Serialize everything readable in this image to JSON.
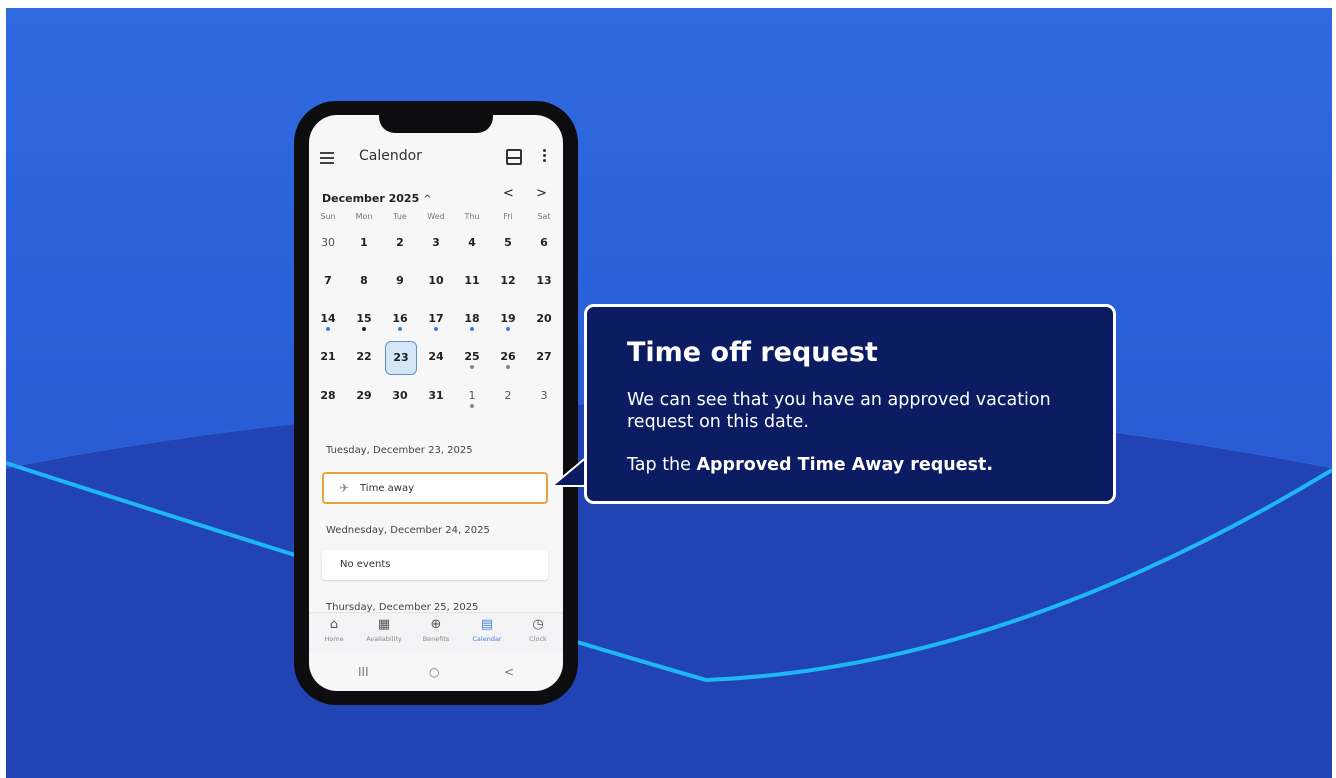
{
  "app": {
    "title": "Calendor"
  },
  "calendar": {
    "month_label": "December 2025",
    "caret": "^",
    "prev": "<",
    "next": ">",
    "weekdays": [
      "Sun",
      "Mon",
      "Tue",
      "Wed",
      "Thu",
      "Fri",
      "Sat"
    ],
    "weeks": [
      [
        "30",
        "1",
        "2",
        "3",
        "4",
        "5",
        "6"
      ],
      [
        "7",
        "8",
        "9",
        "10",
        "11",
        "12",
        "13"
      ],
      [
        "14",
        "15",
        "16",
        "17",
        "18",
        "19",
        "20"
      ],
      [
        "21",
        "22",
        "23",
        "24",
        "25",
        "26",
        "27"
      ],
      [
        "28",
        "29",
        "30",
        "31",
        "1",
        "2",
        "3"
      ]
    ],
    "selected": "23"
  },
  "agenda": {
    "day1_header": "Tuesday, December 23, 2025",
    "day1_event": "Time away",
    "day2_header": "Wednesday, December 24, 2025",
    "day2_event": "No events",
    "day3_header": "Thursday, December 25, 2025"
  },
  "bottom_nav": [
    {
      "label": "Home",
      "icon": "home-icon"
    },
    {
      "label": "Availability",
      "icon": "availability-icon"
    },
    {
      "label": "Benefits",
      "icon": "plus-circle-icon"
    },
    {
      "label": "Calendar",
      "icon": "calendar-icon"
    },
    {
      "label": "Clock",
      "icon": "clock-icon"
    }
  ],
  "system_nav": {
    "recents": "III",
    "home": "○",
    "back": "<"
  },
  "callout": {
    "title": "Time off request",
    "body": "We can see that you have an approved vacation request on this date.",
    "instruction_prefix": "Tap the ",
    "instruction_bold": "Approved Time Away request."
  },
  "colors": {
    "background": "#2a5fd8",
    "callout_bg": "#0c1c63",
    "highlight": "#e8a33a",
    "accent": "#3b7be0"
  }
}
